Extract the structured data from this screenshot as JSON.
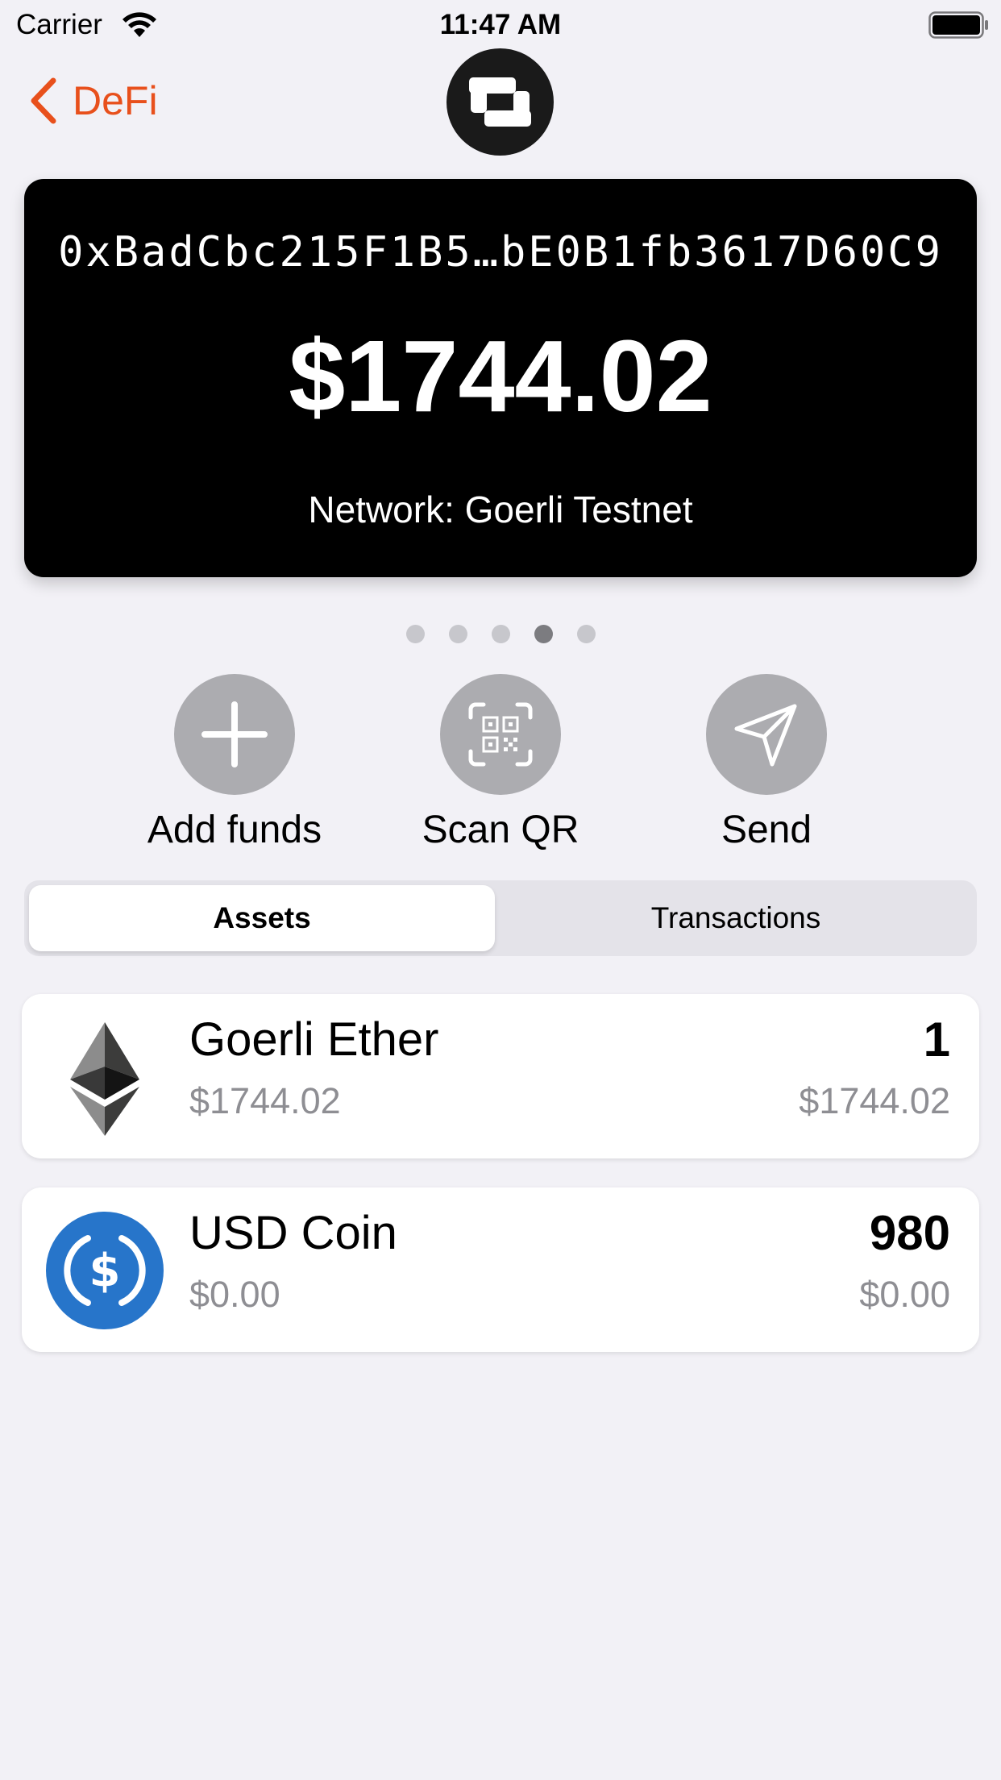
{
  "status_bar": {
    "carrier": "Carrier",
    "time": "11:47 AM",
    "icons": [
      "wifi-icon",
      "battery-icon"
    ]
  },
  "nav": {
    "back_label": "DeFi",
    "accent_color": "#e8501c",
    "logo": "app-logo-icon"
  },
  "wallet_card": {
    "address": "0xBadCbc215F1B5…bE0B1fb3617D60C9",
    "balance": "$1744.02",
    "network": "Network: Goerli Testnet"
  },
  "pager": {
    "pages": 5,
    "current": 4
  },
  "actions": [
    {
      "label": "Add funds",
      "icon": "plus-icon"
    },
    {
      "label": "Scan QR",
      "icon": "qr-code-icon"
    },
    {
      "label": "Send",
      "icon": "send-icon"
    }
  ],
  "tabs": [
    {
      "label": "Assets",
      "selected": true
    },
    {
      "label": "Transactions",
      "selected": false
    }
  ],
  "assets": [
    {
      "name": "Goerli Ether",
      "fiat_price": "$1744.02",
      "quantity": "1",
      "value": "$1744.02",
      "icon": "ethereum-icon"
    },
    {
      "name": "USD Coin",
      "fiat_price": "$0.00",
      "quantity": "980",
      "value": "$0.00",
      "icon": "usdc-icon"
    }
  ]
}
